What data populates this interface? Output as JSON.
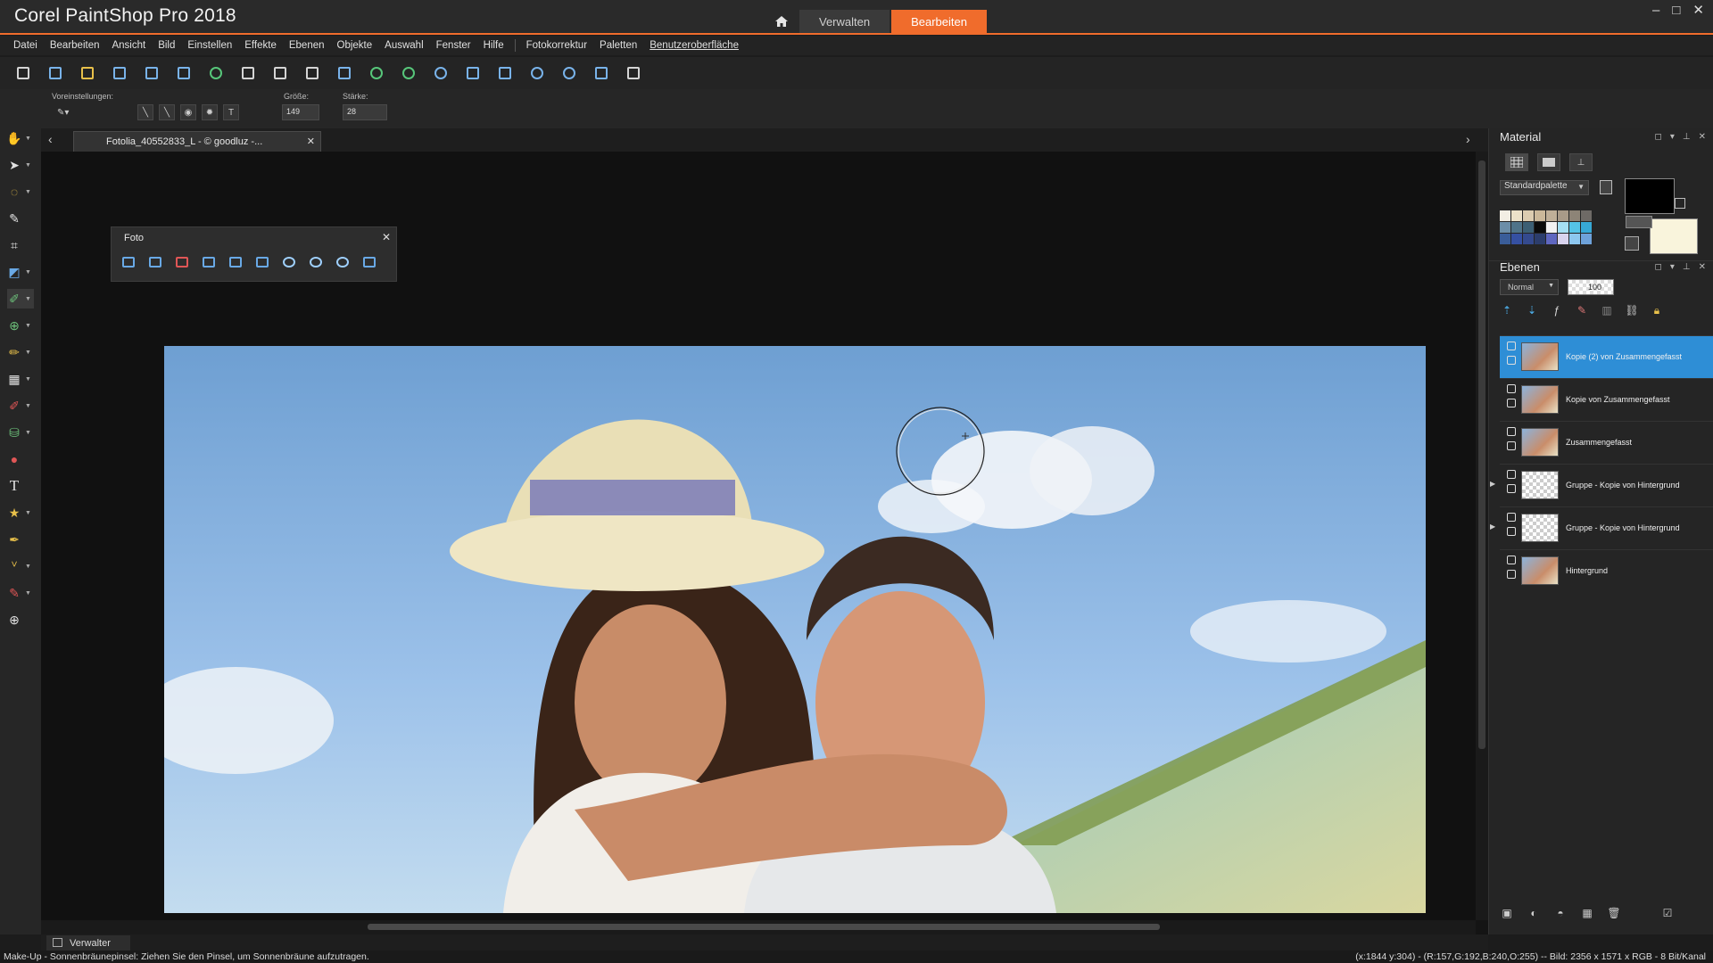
{
  "app": {
    "title": "Corel PaintShop Pro 2018",
    "window_controls": [
      "–",
      "□",
      "✕"
    ]
  },
  "mode_tabs": [
    {
      "label": "Verwalten",
      "active": false
    },
    {
      "label": "Bearbeiten",
      "active": true
    }
  ],
  "colors": {
    "accent": "#f06c2c",
    "selection": "#2e8ed6",
    "foreground": "#000000",
    "background": "#f9f4dc"
  },
  "menu": {
    "items": [
      "Datei",
      "Bearbeiten",
      "Ansicht",
      "Bild",
      "Einstellen",
      "Effekte",
      "Ebenen",
      "Objekte",
      "Auswahl",
      "Fenster",
      "Hilfe"
    ],
    "items2": [
      "Fotokorrektur",
      "Paletten",
      "Benutzeroberfläche"
    ]
  },
  "toolbar": {
    "icons": [
      "new-file-icon",
      "browse-icon",
      "open-icon",
      "scan-icon",
      "save-icon",
      "save-as-icon",
      "share-icon",
      "print-icon",
      "undo-icon",
      "redo-icon",
      "resize-icon",
      "rotate-left-icon",
      "rotate-right-icon",
      "info-icon",
      "fit-window-icon",
      "actual-size-icon",
      "zoom-out-icon",
      "zoom-in-icon",
      "full-screen-icon",
      "paste-icon"
    ]
  },
  "tool_options": {
    "presets_label": "Voreinstellungen:",
    "size_label": "Größe:",
    "size_value": "149",
    "strength_label": "Stärke:",
    "strength_value": "28"
  },
  "tools": [
    "pan-tool-icon",
    "pick-tool-icon",
    "selection-tool-icon",
    "dropper-tool-icon",
    "crop-tool-icon",
    "straighten-tool-icon",
    "makeup-tool-icon",
    "clone-tool-icon",
    "paint-brush-icon",
    "gradient-tool-icon",
    "eraser-icon",
    "fill-tool-icon",
    "red-eye-icon",
    "text-tool-icon",
    "preset-shape-icon",
    "pen-tool-icon",
    "retouch-tool-icon",
    "color-replacer-icon",
    "add-tool-icon"
  ],
  "document": {
    "tab_title": "Fotolia_40552833_L - © goodluz -..."
  },
  "foto_palette": {
    "title": "Foto",
    "icons": [
      "one-step-fix-icon",
      "smart-fix-icon",
      "red-eye-fix-icon",
      "color-balance-icon",
      "levels-icon",
      "hdr-icon",
      "lens-icon",
      "blur-icon",
      "portrait-icon",
      "depth-of-field-icon"
    ]
  },
  "material": {
    "title": "Material",
    "palette_select": "Standardpalette",
    "swatches": [
      "#f3eee4",
      "#ece1c9",
      "#dcccb0",
      "#cbb89a",
      "#bfaf98",
      "#a89a88",
      "#8d8477",
      "#6e6a66",
      "#6c8ea8",
      "#4f7389",
      "#3c5f74",
      "#0b0b0b",
      "#f2f2f2",
      "#a5dff3",
      "#55c4e7",
      "#37a9d6",
      "#3a5d99",
      "#3550a2",
      "#344a8e",
      "#2c3d6c",
      "#5f67c0",
      "#d8d3ee",
      "#8dc7ef",
      "#6ea2da"
    ]
  },
  "layers": {
    "title": "Ebenen",
    "blend_mode": "Normal",
    "opacity": "100",
    "tool_icons": [
      "new-raster-layer-icon",
      "new-vector-layer-icon",
      "new-adjustment-layer-icon",
      "new-mask-layer-icon",
      "duplicate-layer-icon",
      "link-icon",
      "lock-icon"
    ],
    "items": [
      {
        "name": "Kopie (2) von Zusammengefasst",
        "selected": true,
        "group": false
      },
      {
        "name": "Kopie von Zusammengefasst",
        "selected": false,
        "group": false
      },
      {
        "name": "Zusammengefasst",
        "selected": false,
        "group": false
      },
      {
        "name": "Gruppe - Kopie von Hintergrund",
        "selected": false,
        "group": true
      },
      {
        "name": "Gruppe - Kopie von Hintergrund",
        "selected": false,
        "group": true
      },
      {
        "name": "Hintergrund",
        "selected": false,
        "group": false
      }
    ],
    "bottom_icons": [
      "new-layer-icon",
      "mask-icon",
      "blend-icon",
      "merge-icon",
      "delete-icon",
      "properties-icon"
    ]
  },
  "bottom": {
    "tab_label": "Verwalter"
  },
  "status": {
    "left": "Make-Up - Sonnenbräunepinsel: Ziehen Sie den Pinsel, um Sonnenbräune aufzutragen.",
    "right": "(x:1844 y:304) - (R:157,G:192,B:240,O:255) -- Bild: 2356 x 1571 x RGB - 8 Bit/Kanal"
  }
}
